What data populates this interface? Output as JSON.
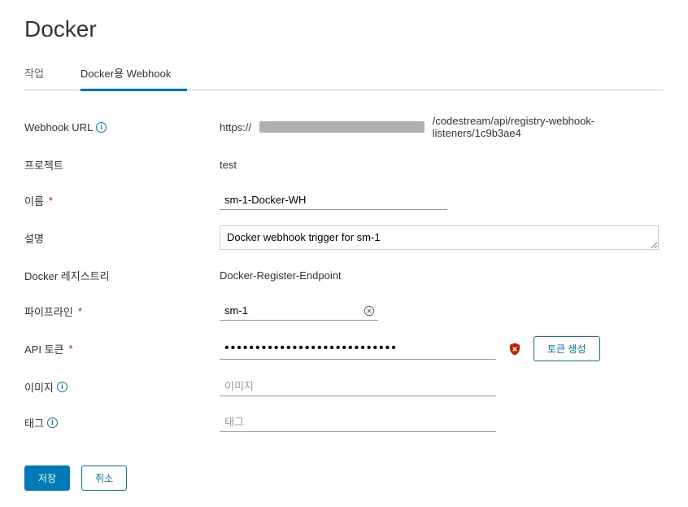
{
  "page": {
    "title": "Docker"
  },
  "tabs": {
    "actions": "작업",
    "webhook": "Docker용 Webhook"
  },
  "form": {
    "webhook_url": {
      "label": "Webhook URL",
      "prefix": "https://",
      "suffix": "/codestream/api/registry-webhook-listeners/1c9b3ae4"
    },
    "project": {
      "label": "프로젝트",
      "value": "test"
    },
    "name": {
      "label": "이름",
      "value": "sm-1-Docker-WH"
    },
    "description": {
      "label": "설명",
      "value": "Docker webhook trigger for sm-1"
    },
    "registry": {
      "label": "Docker 레지스트리",
      "value": "Docker-Register-Endpoint"
    },
    "pipeline": {
      "label": "파이프라인",
      "value": "sm-1"
    },
    "api_token": {
      "label": "API 토큰",
      "value": "••••••••••••••••••••••••••••",
      "generate_btn": "토큰 생성"
    },
    "image": {
      "label": "이미지",
      "placeholder": "이미지"
    },
    "tag": {
      "label": "태그",
      "placeholder": "태그"
    }
  },
  "buttons": {
    "save": "저장",
    "cancel": "취소"
  }
}
